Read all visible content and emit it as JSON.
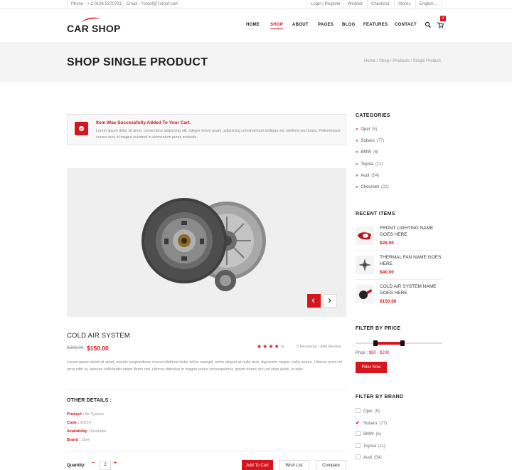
{
  "topbar": {
    "phone": "Phone : + 2 0106 5370701",
    "email": "Email : 7oroof@7oroof.com",
    "links": [
      "Login / Register",
      "Wishlist",
      "Checkout",
      "Stores"
    ],
    "language": "English"
  },
  "header": {
    "logo": "CAR SHOP",
    "nav": [
      "HOME",
      "SHOP",
      "ABOUT",
      "PAGES",
      "BLOG",
      "FEATURES",
      "CONTACT"
    ],
    "active_nav": "SHOP",
    "cart_count": "3"
  },
  "titleband": {
    "title": "SHOP SINGLE PRODUCT",
    "breadcrumb": [
      "Home",
      "Shop",
      "Products",
      "Single Product"
    ]
  },
  "alert": {
    "title": "Item Was Successfully Added To Your Cart.",
    "body": "Lorem ipsum dolor sit amet, consectetur adipiscing elit. Integer lorem quam, adipiscing condimentum tristique vel, eleifend sed turpis. Pellentesque cursus arcu id magna euismod in elementum purus molestie."
  },
  "product": {
    "name": "COLD AIR SYSTEM",
    "old_price": "$200.00",
    "new_price": "$150.00",
    "rating": 4,
    "rating_max": 5,
    "reviews": "5 Review(s)",
    "add_review": "Add Review",
    "description": "Lorem ipsum dolor sit amet, mauris suspendisse viverra eleifend tortor tellus suscipit, tortor aliquet at nulla mus, dignissim neque, nulla neque. Ultrices proin mi urna nibh ut, aenean sollicitudin etiam libero nisl, ultrices ridiculus in magna purus consequuntur, ipsum donec orci ad vitae pede, id odio.",
    "other_details_title": "OTHER DETAILS :",
    "details": [
      {
        "label": "Product :",
        "value": "Air System"
      },
      {
        "label": "Code :",
        "value": "#0214"
      },
      {
        "label": "Availability :",
        "value": "Available"
      },
      {
        "label": "Brand :",
        "value": "Opel"
      }
    ],
    "quantity_label": "Quantity:",
    "quantity": "2",
    "add_to_cart": "Add To Cart",
    "wish_list": "Wish List",
    "compare": "Compare"
  },
  "sidebar": {
    "categories_title": "CATEGORIES",
    "categories": [
      {
        "name": "Opel",
        "count": "(5)"
      },
      {
        "name": "Subaru",
        "count": "(77)"
      },
      {
        "name": "BMW",
        "count": "(6)"
      },
      {
        "name": "Toyota",
        "count": "(11)"
      },
      {
        "name": "Audi",
        "count": "(54)"
      },
      {
        "name": "Chevrolet",
        "count": "(22)"
      }
    ],
    "recent_title": "RECENT ITEMS",
    "recent": [
      {
        "name": "FRONT LIGHTING NAME GOES HERE",
        "price": "$28.00"
      },
      {
        "name": "THERMAL FAN NAME GOES HERE",
        "price": "$40.00"
      },
      {
        "name": "COLD AIR SYSTEM NAME GOES HERE",
        "price": "$150.00"
      }
    ],
    "price_title": "FILTER BY PRICE",
    "price_label": "Price :",
    "price_value": "$50 - $200",
    "filter_button": "Filter Now",
    "brand_title": "FILTER BY BRAND",
    "brands": [
      {
        "name": "Opel",
        "count": "(5)",
        "checked": false
      },
      {
        "name": "Subaru",
        "count": "(77)",
        "checked": true
      },
      {
        "name": "BMW",
        "count": "(6)",
        "checked": false
      },
      {
        "name": "Toyota",
        "count": "(11)",
        "checked": false
      },
      {
        "name": "Audi",
        "count": "(54)",
        "checked": false
      }
    ]
  },
  "colors": {
    "accent": "#d7151e",
    "band": "#f4f4f4"
  }
}
